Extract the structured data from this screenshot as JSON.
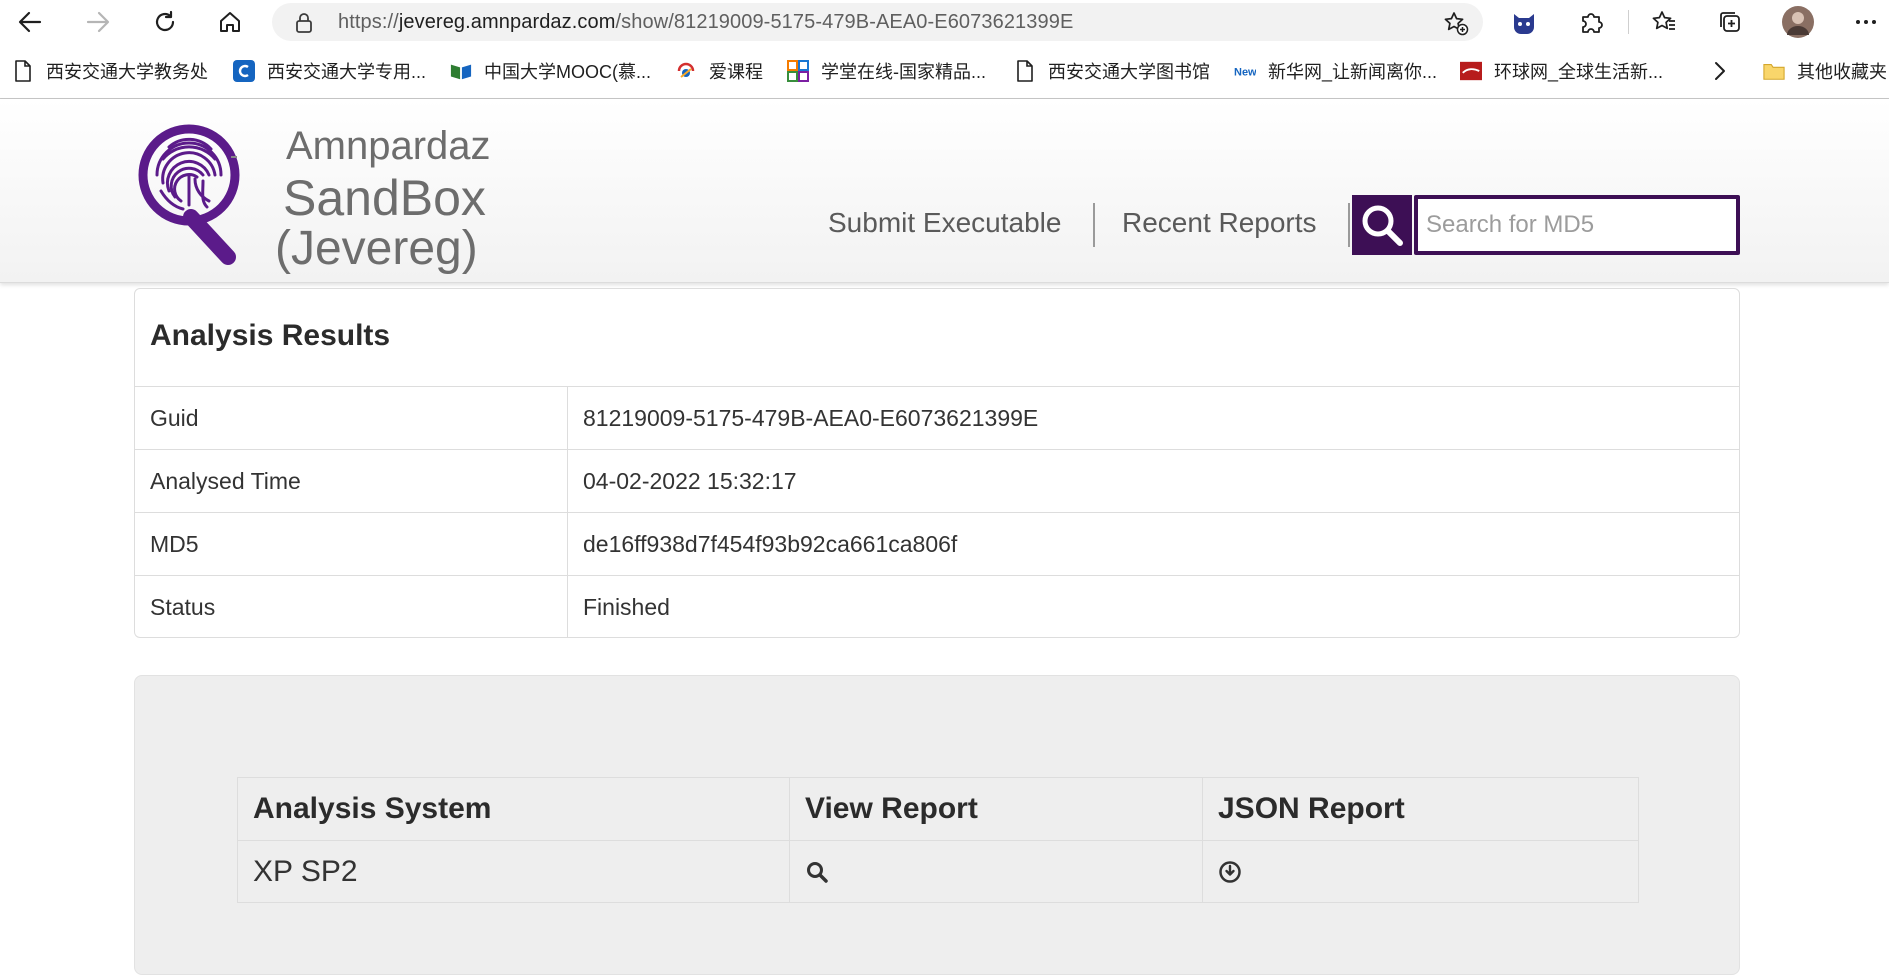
{
  "browser": {
    "url_prefix": "https://",
    "url_host": "jevereg.amnpardaz.com",
    "url_path": "/show/81219009-5175-479B-AEA0-E6073621399E",
    "bookmarks": [
      {
        "label": "西安交通大学教务处",
        "icon": "page-icon"
      },
      {
        "label": "西安交通大学专用...",
        "icon": "c-logo-icon"
      },
      {
        "label": "中国大学MOOC(慕...",
        "icon": "book-icon"
      },
      {
        "label": "爱课程",
        "icon": "aikecheng-icon"
      },
      {
        "label": "学堂在线-国家精品...",
        "icon": "grid-logo-icon"
      },
      {
        "label": "西安交通大学图书馆",
        "icon": "page-icon"
      },
      {
        "label": "新华网_让新闻离你...",
        "icon": "news-icon"
      },
      {
        "label": "环球网_全球生活新...",
        "icon": "huanqiu-icon"
      }
    ],
    "other_bookmarks": "其他收藏夹",
    "colors": {
      "accent": "#3d0f55"
    }
  },
  "site": {
    "logo_line1": "Amnpardaz",
    "logo_line2": "SandBox",
    "logo_line3": "(Jevereg)",
    "nav": {
      "submit": "Submit Executable",
      "recent": "Recent Reports"
    },
    "search_placeholder": "Search for MD5"
  },
  "results": {
    "title": "Analysis Results",
    "rows": [
      {
        "key": "Guid",
        "value": "81219009-5175-479B-AEA0-E6073621399E"
      },
      {
        "key": "Analysed Time",
        "value": "04-02-2022 15:32:17"
      },
      {
        "key": "MD5",
        "value": "de16ff938d7f454f93b92ca661ca806f"
      },
      {
        "key": "Status",
        "value": "Finished"
      }
    ]
  },
  "systems": {
    "headers": {
      "system": "Analysis System",
      "view": "View Report",
      "json": "JSON Report"
    },
    "rows": [
      {
        "system": "XP SP2",
        "view_icon": "search-icon",
        "json_icon": "download-icon"
      }
    ]
  }
}
